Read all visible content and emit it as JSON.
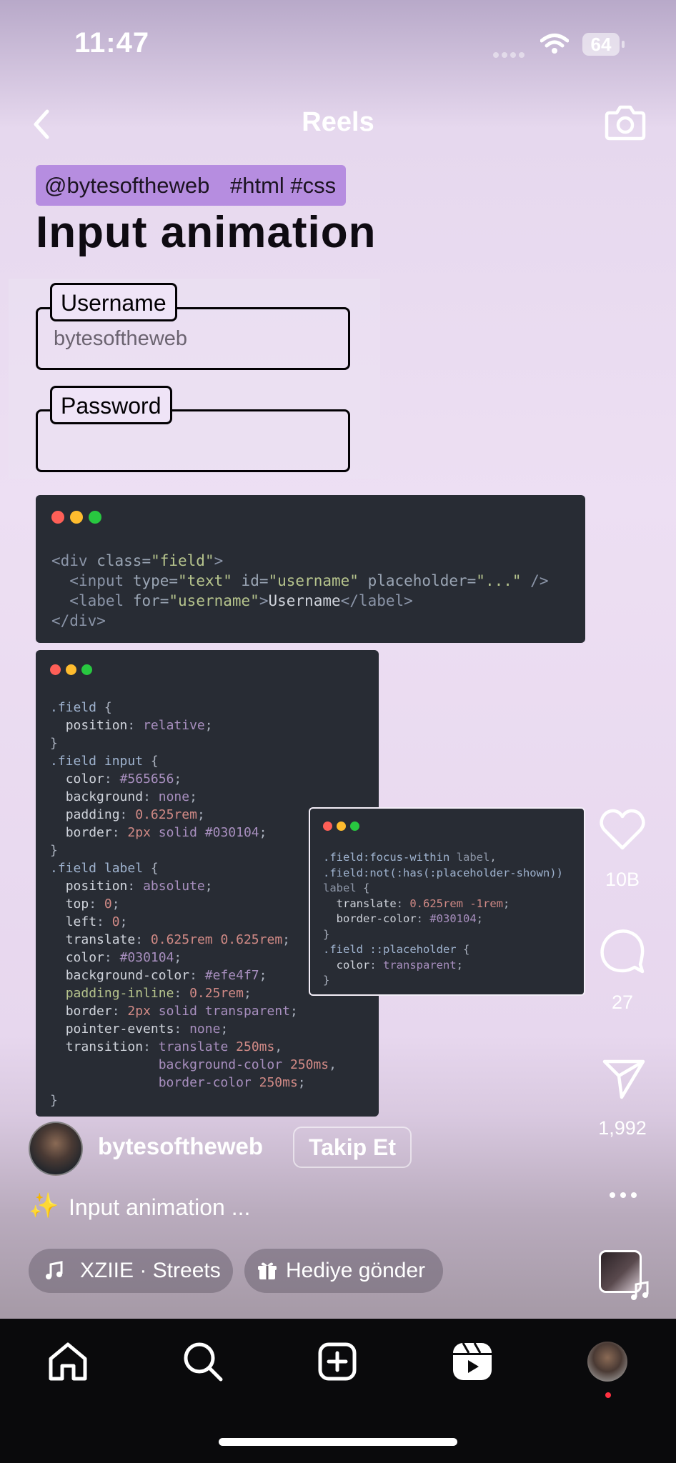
{
  "status": {
    "time": "11:47",
    "battery": "64"
  },
  "header": {
    "title": "Reels"
  },
  "post": {
    "tags": [
      "@bytesoftheweb",
      "#html #css"
    ],
    "headline": "Input animation",
    "demo": {
      "username_label": "Username",
      "username_placeholder": "bytesoftheweb",
      "password_label": "Password"
    },
    "colors": {
      "accent_tag": "#b68de0",
      "code_bg": "#282c34",
      "page_bg": "#eddff3"
    }
  },
  "actions": {
    "likes": "10B",
    "comments": "27",
    "shares": "1,992"
  },
  "author": {
    "name": "bytesoftheweb",
    "follow_label": "Takip Et"
  },
  "caption": {
    "emoji": "✨",
    "text": "Input animation ..."
  },
  "music": {
    "label": "XZIIE · Streets"
  },
  "gift": {
    "label": "Hediye gönder"
  },
  "tabbar": {
    "items": [
      "home-icon",
      "search-icon",
      "create-icon",
      "reels-icon",
      "profile-avatar"
    ]
  }
}
